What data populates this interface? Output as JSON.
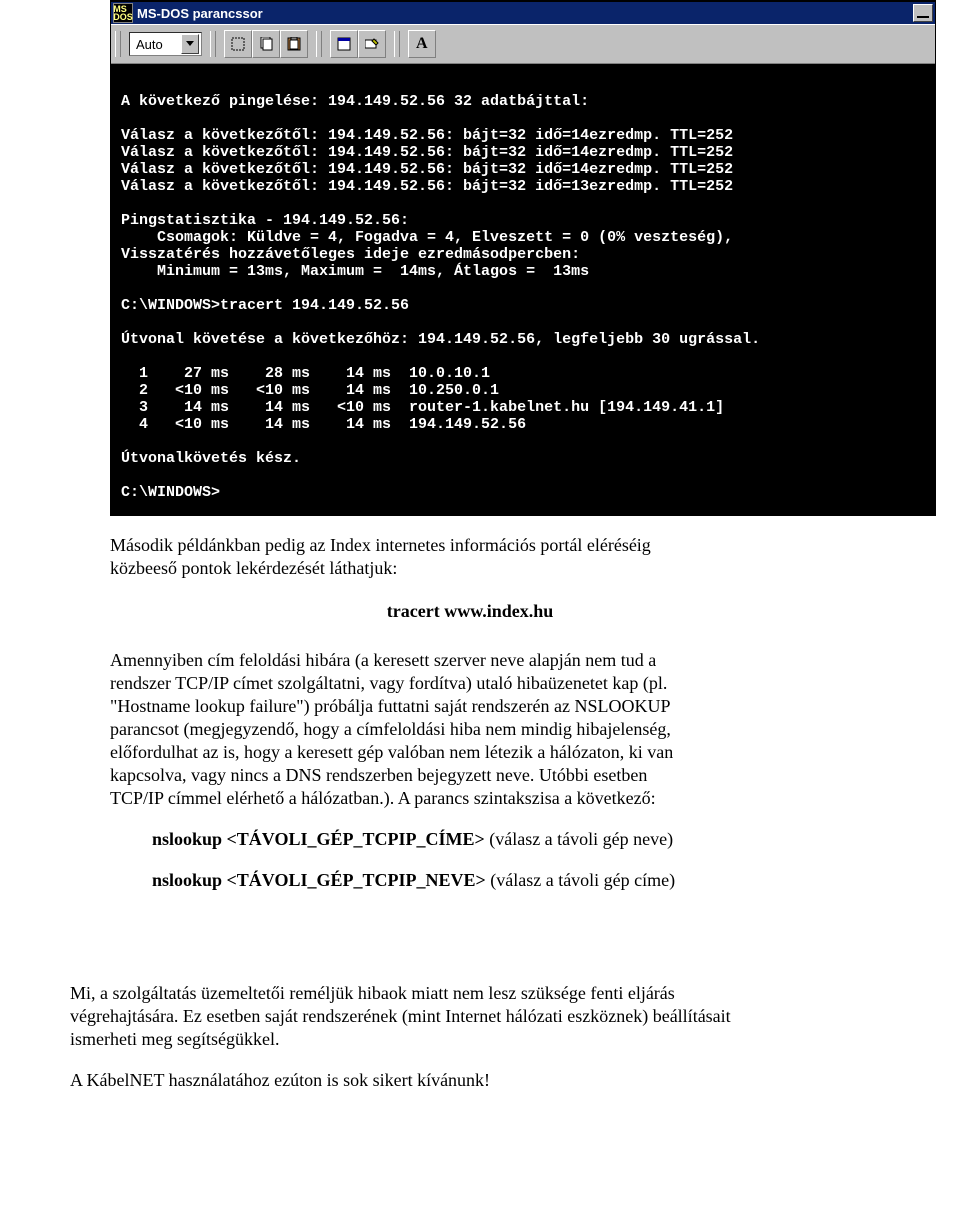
{
  "window": {
    "title": "MS-DOS parancssor",
    "toolbar": {
      "combo_value": "Auto"
    }
  },
  "console": {
    "lines": [
      "",
      "A következő pingelése: 194.149.52.56 32 adatbájttal:",
      "",
      "Válasz a következőtől: 194.149.52.56: bájt=32 idő=14ezredmp. TTL=252",
      "Válasz a következőtől: 194.149.52.56: bájt=32 idő=14ezredmp. TTL=252",
      "Válasz a következőtől: 194.149.52.56: bájt=32 idő=14ezredmp. TTL=252",
      "Válasz a következőtől: 194.149.52.56: bájt=32 idő=13ezredmp. TTL=252",
      "",
      "Pingstatisztika - 194.149.52.56:",
      "    Csomagok: Küldve = 4, Fogadva = 4, Elveszett = 0 (0% veszteség),",
      "Visszatérés hozzávetőleges ideje ezredmásodpercben:",
      "    Minimum = 13ms, Maximum =  14ms, Átlagos =  13ms",
      "",
      "C:\\WINDOWS>tracert 194.149.52.56",
      "",
      "Útvonal követése a következőhöz: 194.149.52.56, legfeljebb 30 ugrással.",
      "",
      "  1    27 ms    28 ms    14 ms  10.0.10.1",
      "  2   <10 ms   <10 ms    14 ms  10.250.0.1",
      "  3    14 ms    14 ms   <10 ms  router-1.kabelnet.hu [194.149.41.1]",
      "  4   <10 ms    14 ms    14 ms  194.149.52.56",
      "",
      "Útvonalkövetés kész.",
      "",
      "C:\\WINDOWS>"
    ]
  },
  "doc": {
    "p1a": "Második példánkban pedig az Index internetes információs portál eléréséig",
    "p1b": "közbeeső pontok lekérdezését láthatjuk:",
    "cmd1": "tracert www.index.hu",
    "p2a": "Amennyiben cím feloldási hibára (a keresett szerver neve alapján nem tud a",
    "p2b": "rendszer TCP/IP címet szolgáltatni, vagy fordítva) utaló hibaüzenetet kap (pl.",
    "p2c": "\"Hostname lookup failure\") próbálja futtatni saját rendszerén az NSLOOKUP",
    "p2d": "parancsot (megjegyzendő, hogy a címfeloldási hiba nem mindig hibajelenség,",
    "p2e": "előfordulhat az is, hogy a keresett gép valóban nem létezik a hálózaton, ki van",
    "p2f": "kapcsolva, vagy nincs a DNS rendszerben bejegyzett neve. Utóbbi esetben",
    "p2g": "TCP/IP címmel elérhető a hálózatban.). A parancs szintakszisa a következő:",
    "cmd2a_b": "nslookup <TÁVOLI_GÉP_TCPIP_CÍME>",
    "cmd2a_n": " (válasz a távoli gép neve)",
    "cmd2b_b": "nslookup <TÁVOLI_GÉP_TCPIP_NEVE>",
    "cmd2b_n": " (válasz a távoli gép címe)",
    "p3a": "Mi, a szolgáltatás üzemeltetői reméljük hibaok miatt nem lesz szüksége fenti eljárás",
    "p3b": "végrehajtására. Ez esetben saját rendszerének (mint Internet hálózati eszköznek) beállításait",
    "p3c": "ismerheti meg segítségükkel.",
    "p4": "A KábelNET használatához ezúton is sok sikert kívánunk!"
  }
}
